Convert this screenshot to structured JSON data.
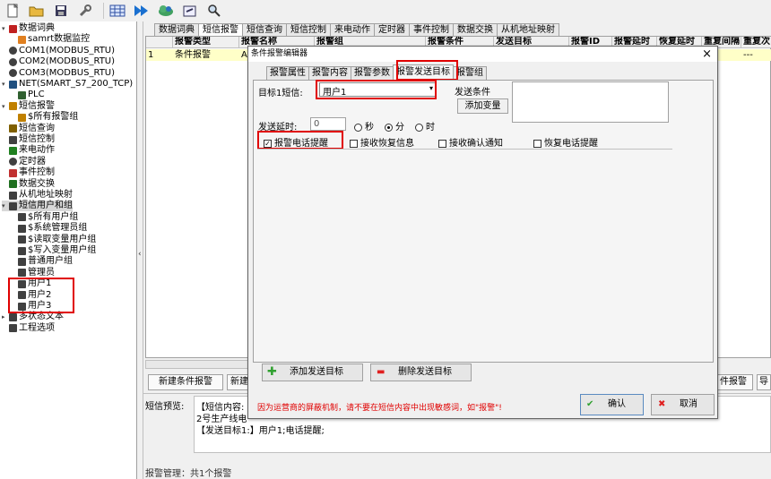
{
  "tree": [
    {
      "label": "数据词典",
      "indent": 0,
      "expand": "-",
      "icon": "diamond",
      "color": "#c02020"
    },
    {
      "label": "samrt数据监控",
      "indent": 2,
      "icon": "db",
      "color": "#e08020"
    },
    {
      "label": "COM1(MODBUS_RTU)",
      "indent": 0,
      "icon": "link",
      "color": "#404040"
    },
    {
      "label": "COM2(MODBUS_RTU)",
      "indent": 0,
      "icon": "link",
      "color": "#404040"
    },
    {
      "label": "COM3(MODBUS_RTU)",
      "indent": 0,
      "icon": "link",
      "color": "#404040"
    },
    {
      "label": "NET(SMART_S7_200_TCP)",
      "indent": 0,
      "expand": "-",
      "icon": "net",
      "color": "#205080"
    },
    {
      "label": "PLC",
      "indent": 2,
      "icon": "plc",
      "color": "#306030"
    },
    {
      "label": "短信报警",
      "indent": 0,
      "expand": "-",
      "icon": "bell",
      "color": "#c08000"
    },
    {
      "label": "$所有报警组",
      "indent": 2,
      "icon": "bell",
      "color": "#c08000"
    },
    {
      "label": "短信查询",
      "indent": 0,
      "icon": "search",
      "color": "#806000"
    },
    {
      "label": "短信控制",
      "indent": 0,
      "icon": "ctrl",
      "color": "#404040"
    },
    {
      "label": "来电动作",
      "indent": 0,
      "icon": "phone",
      "color": "#208020"
    },
    {
      "label": "定时器",
      "indent": 0,
      "icon": "clock",
      "color": "#404040"
    },
    {
      "label": "事件控制",
      "indent": 0,
      "icon": "event",
      "color": "#c03030"
    },
    {
      "label": "数据交换",
      "indent": 0,
      "icon": "swap",
      "color": "#207020"
    },
    {
      "label": "从机地址映射",
      "indent": 0,
      "icon": "map",
      "color": "#404040"
    },
    {
      "label": "短信用户和组",
      "indent": 0,
      "expand": "-",
      "icon": "users",
      "color": "#404040",
      "selected": true
    },
    {
      "label": "$所有用户组",
      "indent": 2,
      "icon": "users",
      "color": "#404040"
    },
    {
      "label": "$系统管理员组",
      "indent": 2,
      "icon": "users",
      "color": "#404040"
    },
    {
      "label": "$读取变量用户组",
      "indent": 2,
      "icon": "users",
      "color": "#404040"
    },
    {
      "label": "$写入变量用户组",
      "indent": 2,
      "icon": "users",
      "color": "#404040"
    },
    {
      "label": "普通用户组",
      "indent": 2,
      "icon": "users",
      "color": "#404040"
    },
    {
      "label": "管理员",
      "indent": 2,
      "icon": "user",
      "color": "#404040"
    },
    {
      "label": "用户1",
      "indent": 2,
      "icon": "user",
      "color": "#404040"
    },
    {
      "label": "用户2",
      "indent": 2,
      "icon": "user",
      "color": "#404040"
    },
    {
      "label": "用户3",
      "indent": 2,
      "icon": "user",
      "color": "#404040"
    },
    {
      "label": "多状态文本",
      "indent": 0,
      "expand": "+",
      "icon": "text",
      "color": "#404040"
    },
    {
      "label": "工程选项",
      "indent": 0,
      "icon": "tool",
      "color": "#404040"
    }
  ],
  "main_tabs": [
    "数据词典",
    "短信报警",
    "短信查询",
    "短信控制",
    "来电动作",
    "定时器",
    "事件控制",
    "数据交换",
    "从机地址映射"
  ],
  "grid": {
    "headers": [
      "",
      "报警类型",
      "报警名称",
      "报警组",
      "报警条件",
      "发送目标",
      "报警ID",
      "报警延时",
      "恢复延时",
      "重复间隔",
      "重复次"
    ],
    "row": [
      "1",
      "条件报警",
      "A1",
      "",
      "",
      "",
      "",
      "",
      "",
      "",
      "---"
    ]
  },
  "bottom_buttons": {
    "new_alarm": "新建条件报警",
    "new2": "新建",
    "alarm_right": "件报警",
    "right2": "导"
  },
  "preview": {
    "label": "短信预览:",
    "line1": "【短信内容:",
    "line2": "2号生产线电",
    "line3": "【发送目标1:】用户1;电话提醒;"
  },
  "status": "报警管理：共1个报警",
  "dialog": {
    "title": "条件报警编辑器",
    "close": "×",
    "tabs": [
      "报警属性",
      "报警内容",
      "报警参数",
      "报警发送目标",
      "报警组"
    ],
    "target_label": "目标1短信:",
    "target_value": "用户1",
    "send_condition_label": "发送条件",
    "add_variable": "添加变量",
    "delay_label": "发送延时:",
    "delay_value": "0",
    "unit_sec": "秒",
    "unit_min": "分",
    "unit_hour": "时",
    "chk_phone": "报警电话提醒",
    "chk_recover": "接收恢复信息",
    "chk_confirm": "接收确认通知",
    "chk_recover_phone": "恢复电话提醒",
    "add_target": "添加发送目标",
    "del_target": "删除发送目标",
    "warning": "因为运营商的屏蔽机制，请不要在短信内容中出现敏感词，如\"报警\"!",
    "ok": "确认",
    "cancel": "取消"
  }
}
